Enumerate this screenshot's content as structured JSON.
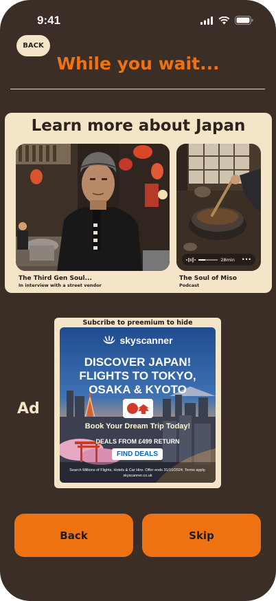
{
  "status_bar": {
    "time": "9:41"
  },
  "header": {
    "back_label": "BACK",
    "title": "While you wait..."
  },
  "learn": {
    "title": "Learn more about Japan",
    "items": [
      {
        "title": "The Third Gen Soul...",
        "subtitle": "In interview with a street vendor"
      },
      {
        "title": "The Soul of Miso",
        "subtitle": "Podcast",
        "duration": "28min"
      }
    ]
  },
  "ad": {
    "label": "Ad",
    "subscribe_text": "Subcribe to preemium to hide",
    "brand": "skyscanner",
    "headline_lines": [
      "DISCOVER JAPAN!",
      "FLIGHTS TO TOKYO,",
      "OSAKA & KYOTO"
    ],
    "tagline": "Book Your Dream Trip Today!",
    "deals": "DEALS FROM £499 RETURN",
    "cta": "FIND DEALS",
    "fine_print": "Search Millions of Flights, Hotels & Car Hire. Offer ends 31/10/2024. Terms apply.",
    "url": "skyscanner.co.uk"
  },
  "footer": {
    "back_label": "Back",
    "skip_label": "Skip"
  },
  "colors": {
    "background": "#3b2e27",
    "accent": "#ee7212",
    "cream": "#f4e4c8"
  }
}
